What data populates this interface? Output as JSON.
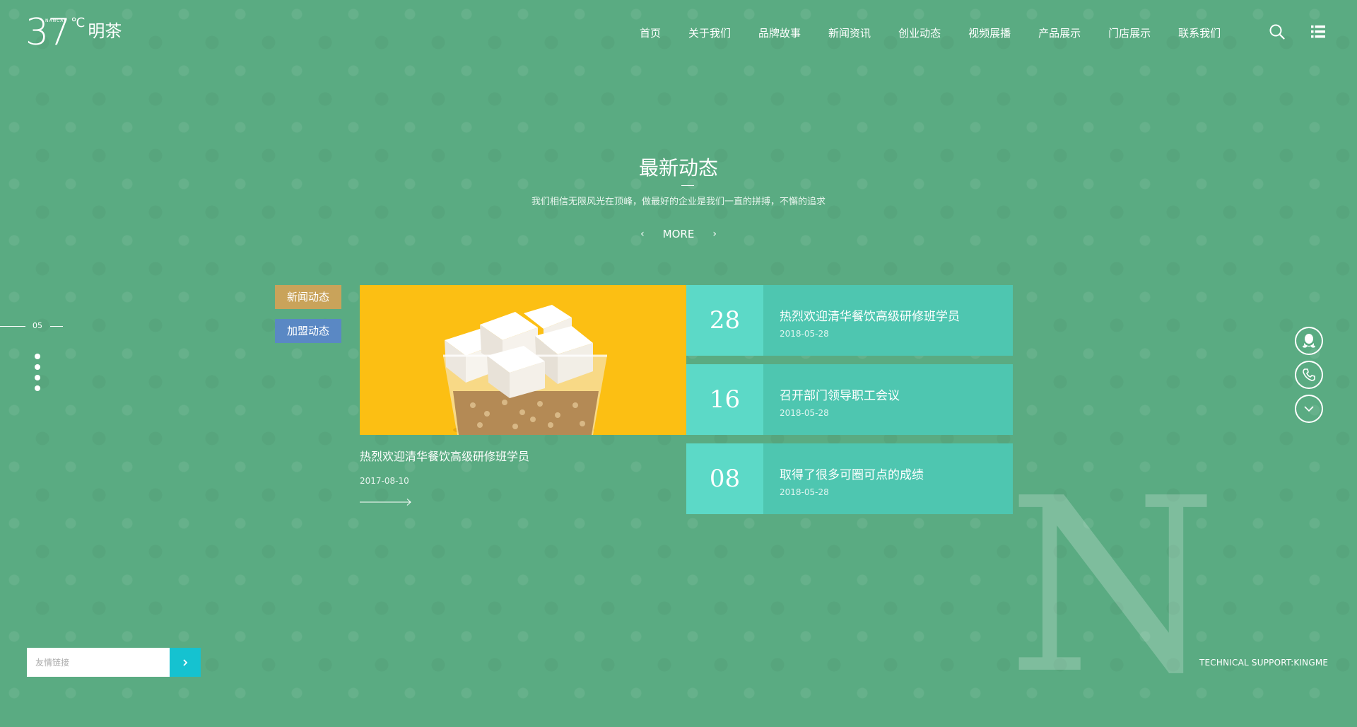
{
  "header": {
    "logo": {
      "number": "37",
      "superscript": "NANCAI",
      "degree": "℃",
      "brand": "明茶"
    },
    "nav": [
      "首页",
      "关于我们",
      "品牌故事",
      "新闻资讯",
      "创业动态",
      "视频展播",
      "产品展示",
      "门店展示",
      "联系我们"
    ]
  },
  "section": {
    "title": "最新动态",
    "subtitle": "我们相信无限风光在顶峰，做最好的企业是我们一直的拼搏，不懈的追求",
    "more": "MORE"
  },
  "tabs": [
    "新闻动态",
    "加盟动态"
  ],
  "featured": {
    "title": "热烈欢迎清华餐饮高级研修班学员",
    "date": "2017-08-10"
  },
  "news": [
    {
      "day": "28",
      "title": "热烈欢迎清华餐饮高级研修班学员",
      "date": "2018-05-28"
    },
    {
      "day": "16",
      "title": "召开部门领导职工会议",
      "date": "2018-05-28"
    },
    {
      "day": "08",
      "title": "取得了很多可圈可点的成绩",
      "date": "2018-05-28"
    }
  ],
  "pager": {
    "current": "05"
  },
  "decor": {
    "letter": "N"
  },
  "footer": {
    "link_placeholder": "友情链接",
    "tech_support": "TECHNICAL SUPPORT:KINGME"
  },
  "colors": {
    "background": "#5aab82",
    "tab_news": "#c9a35a",
    "tab_join": "#5a88c4",
    "card": "#4ec6b0",
    "card_day": "#5cd9c7",
    "featured_bg": "#fcbf13",
    "link_button": "#15c2d0"
  }
}
